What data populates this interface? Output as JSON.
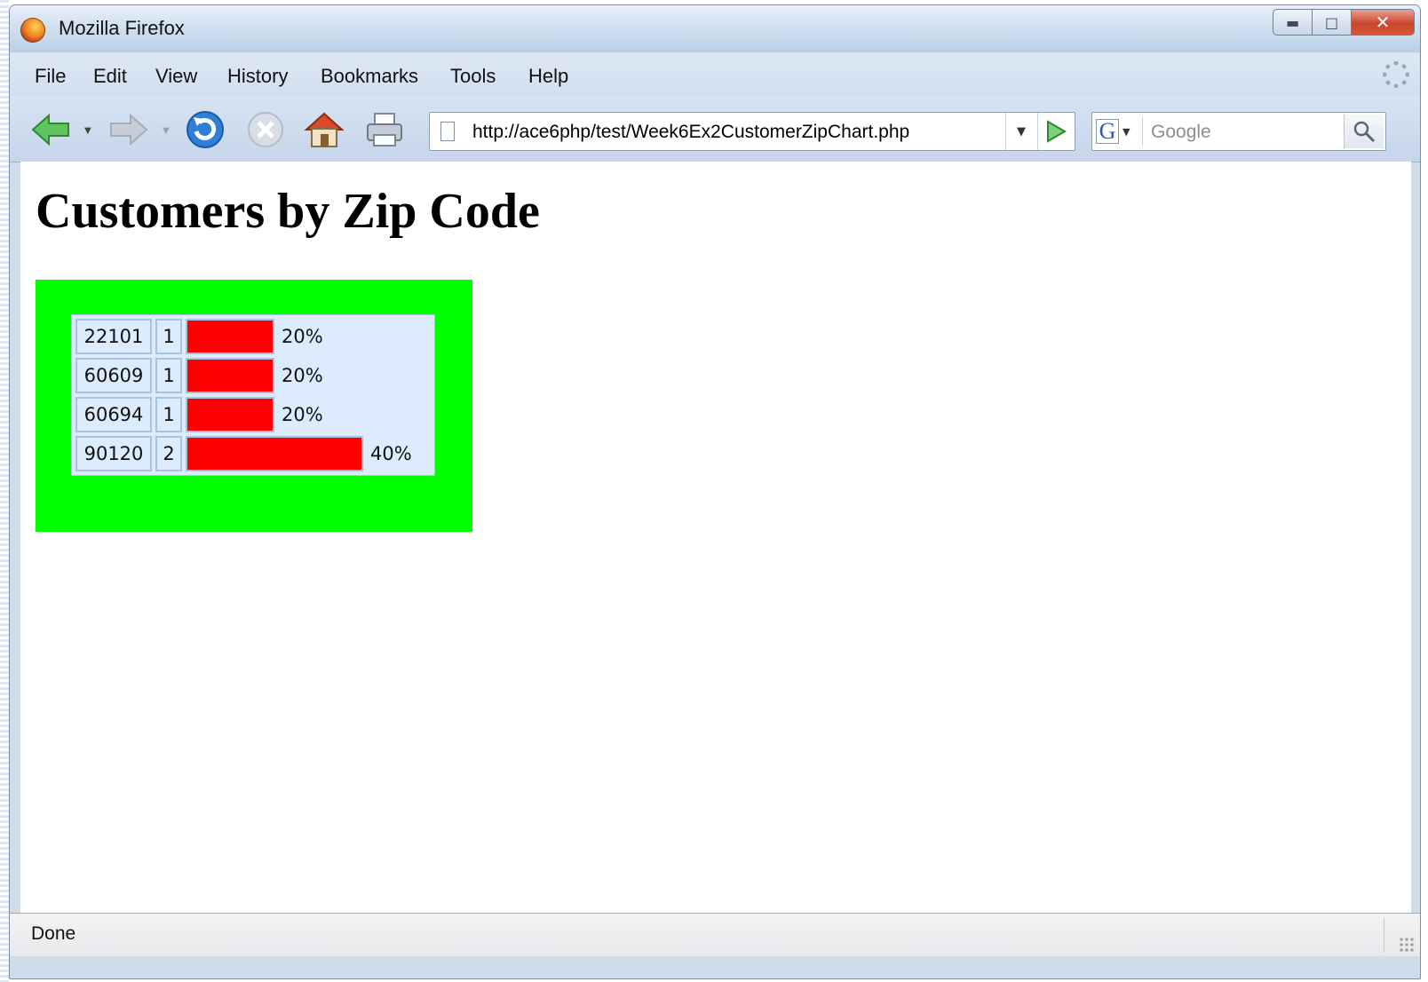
{
  "window": {
    "title": "Mozilla Firefox"
  },
  "menu": {
    "items": [
      {
        "label": "File"
      },
      {
        "label": "Edit"
      },
      {
        "label": "View"
      },
      {
        "label": "History"
      },
      {
        "label": "Bookmarks"
      },
      {
        "label": "Tools"
      },
      {
        "label": "Help"
      }
    ]
  },
  "toolbar": {
    "back_icon": "back-arrow-icon",
    "forward_icon": "forward-arrow-icon",
    "reload_icon": "reload-icon",
    "stop_icon": "stop-icon",
    "home_icon": "home-icon",
    "print_icon": "printer-icon",
    "url": "http://ace6php/test/Week6Ex2CustomerZipChart.php",
    "search_placeholder": "Google"
  },
  "page": {
    "title": "Customers by Zip Code",
    "chart_background": "#00ff00",
    "bar_color": "#ff0000",
    "rows": [
      {
        "zip": "22101",
        "count": "1",
        "percent_label": "20%",
        "percent": 20
      },
      {
        "zip": "60609",
        "count": "1",
        "percent_label": "20%",
        "percent": 20
      },
      {
        "zip": "60694",
        "count": "1",
        "percent_label": "20%",
        "percent": 20
      },
      {
        "zip": "90120",
        "count": "2",
        "percent_label": "40%",
        "percent": 40
      }
    ]
  },
  "status": {
    "text": "Done"
  }
}
